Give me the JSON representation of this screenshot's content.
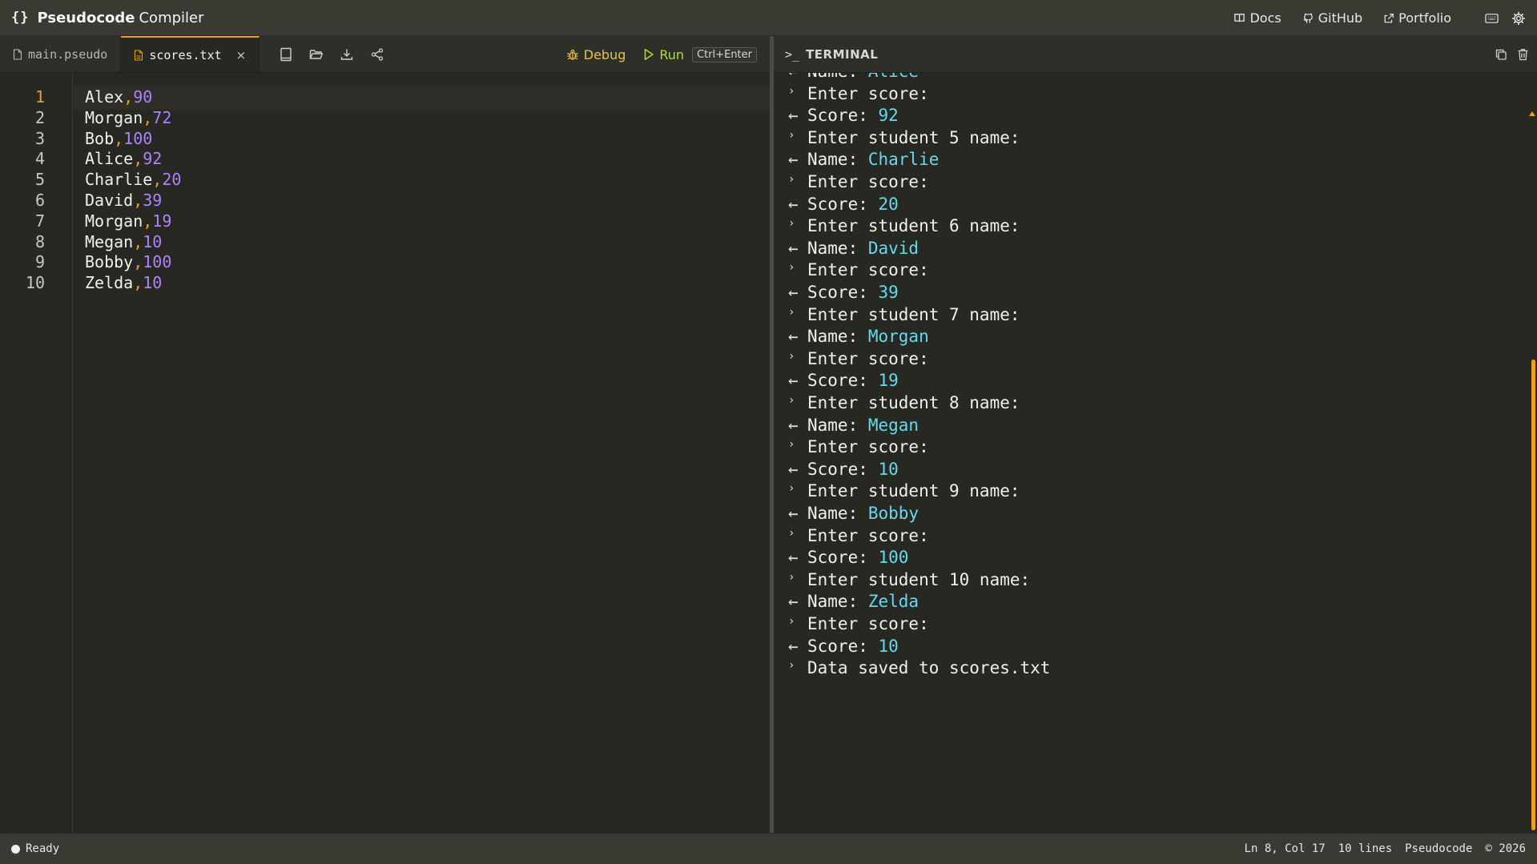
{
  "app": {
    "logo": "{}",
    "name_bold": "Pseudocode",
    "name_rest": "Compiler"
  },
  "header_links": [
    {
      "label": "Docs",
      "icon": "book-icon"
    },
    {
      "label": "GitHub",
      "icon": "github-icon"
    },
    {
      "label": "Portfolio",
      "icon": "external-link-icon"
    }
  ],
  "header_icons": [
    "keyboard-icon",
    "gear-icon"
  ],
  "tabs": [
    {
      "label": "main.pseudo",
      "active": false
    },
    {
      "label": "scores.txt",
      "active": true,
      "close": "×"
    }
  ],
  "toolbar": {
    "debug_label": "Debug",
    "run_label": "Run",
    "run_shortcut": "Ctrl+Enter"
  },
  "editor": {
    "current_line": 1,
    "lines": [
      {
        "num": "1",
        "name": "Alex",
        "sep": ",",
        "score": "90"
      },
      {
        "num": "2",
        "name": "Morgan",
        "sep": ",",
        "score": "72"
      },
      {
        "num": "3",
        "name": "Bob",
        "sep": ",",
        "score": "100"
      },
      {
        "num": "4",
        "name": "Alice",
        "sep": ",",
        "score": "92"
      },
      {
        "num": "5",
        "name": "Charlie",
        "sep": ",",
        "score": "20"
      },
      {
        "num": "6",
        "name": "David",
        "sep": ",",
        "score": "39"
      },
      {
        "num": "7",
        "name": "Morgan",
        "sep": ",",
        "score": "19"
      },
      {
        "num": "8",
        "name": "Megan",
        "sep": ",",
        "score": "10"
      },
      {
        "num": "9",
        "name": "Bobby",
        "sep": ",",
        "score": "100"
      },
      {
        "num": "10",
        "name": "Zelda",
        "sep": ",",
        "score": "10"
      }
    ]
  },
  "terminal": {
    "prompt": ">_",
    "title": "TERMINAL",
    "lines": [
      {
        "kind": "in",
        "mark": "←",
        "text": "Name: ",
        "value": "Alice"
      },
      {
        "kind": "out",
        "mark": "›",
        "text": "Enter score:",
        "value": ""
      },
      {
        "kind": "in",
        "mark": "←",
        "text": "Score: ",
        "value": "92"
      },
      {
        "kind": "out",
        "mark": "›",
        "text": "Enter student 5 name:",
        "value": ""
      },
      {
        "kind": "in",
        "mark": "←",
        "text": "Name: ",
        "value": "Charlie"
      },
      {
        "kind": "out",
        "mark": "›",
        "text": "Enter score:",
        "value": ""
      },
      {
        "kind": "in",
        "mark": "←",
        "text": "Score: ",
        "value": "20"
      },
      {
        "kind": "out",
        "mark": "›",
        "text": "Enter student 6 name:",
        "value": ""
      },
      {
        "kind": "in",
        "mark": "←",
        "text": "Name: ",
        "value": "David"
      },
      {
        "kind": "out",
        "mark": "›",
        "text": "Enter score:",
        "value": ""
      },
      {
        "kind": "in",
        "mark": "←",
        "text": "Score: ",
        "value": "39"
      },
      {
        "kind": "out",
        "mark": "›",
        "text": "Enter student 7 name:",
        "value": ""
      },
      {
        "kind": "in",
        "mark": "←",
        "text": "Name: ",
        "value": "Morgan"
      },
      {
        "kind": "out",
        "mark": "›",
        "text": "Enter score:",
        "value": ""
      },
      {
        "kind": "in",
        "mark": "←",
        "text": "Score: ",
        "value": "19"
      },
      {
        "kind": "out",
        "mark": "›",
        "text": "Enter student 8 name:",
        "value": ""
      },
      {
        "kind": "in",
        "mark": "←",
        "text": "Name: ",
        "value": "Megan"
      },
      {
        "kind": "out",
        "mark": "›",
        "text": "Enter score:",
        "value": ""
      },
      {
        "kind": "in",
        "mark": "←",
        "text": "Score: ",
        "value": "10"
      },
      {
        "kind": "out",
        "mark": "›",
        "text": "Enter student 9 name:",
        "value": ""
      },
      {
        "kind": "in",
        "mark": "←",
        "text": "Name: ",
        "value": "Bobby"
      },
      {
        "kind": "out",
        "mark": "›",
        "text": "Enter score:",
        "value": ""
      },
      {
        "kind": "in",
        "mark": "←",
        "text": "Score: ",
        "value": "100"
      },
      {
        "kind": "out",
        "mark": "›",
        "text": "Enter student 10 name:",
        "value": ""
      },
      {
        "kind": "in",
        "mark": "←",
        "text": "Name: ",
        "value": "Zelda"
      },
      {
        "kind": "out",
        "mark": "›",
        "text": "Enter score:",
        "value": ""
      },
      {
        "kind": "in",
        "mark": "←",
        "text": "Score: ",
        "value": "10"
      },
      {
        "kind": "out",
        "mark": "›",
        "text": "Data saved to scores.txt",
        "value": ""
      }
    ]
  },
  "status": {
    "state": "Ready",
    "cursor": "Ln 8, Col 17",
    "line_count": "10 lines",
    "language": "Pseudocode",
    "copyright": "© 2026"
  },
  "colors": {
    "accent": "#e0a02a",
    "run": "#a6e22e",
    "debug": "#e6c24a",
    "number": "#ae81ff",
    "comma": "#f39c12",
    "terminal_value": "#66d9ef"
  }
}
